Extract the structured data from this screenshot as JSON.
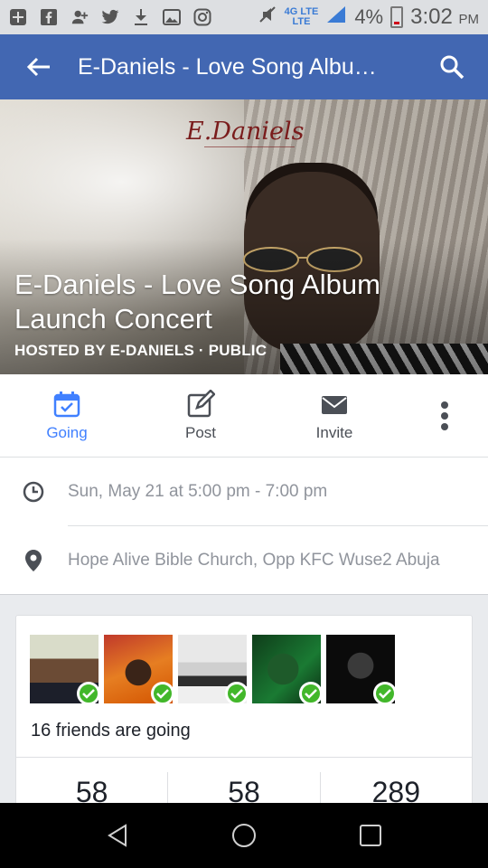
{
  "status_bar": {
    "network_line1": "4G LTE",
    "network_line2": "LTE",
    "battery": "4%",
    "time": "3:02",
    "ampm": "PM",
    "icons": [
      "add-box-icon",
      "facebook-icon",
      "user-add-icon",
      "twitter-icon",
      "download-icon",
      "image-icon",
      "instagram-icon",
      "mute-icon",
      "signal-icon",
      "battery-icon"
    ]
  },
  "appbar": {
    "title": "E-Daniels - Love Song Albu…",
    "back_icon": "arrow-left-icon",
    "search_icon": "search-icon"
  },
  "cover": {
    "logo_text": "E.Daniels",
    "title": "E-Daniels - Love Song Album Launch Concert",
    "hosted": "HOSTED BY E-DANIELS · PUBLIC"
  },
  "actions": {
    "going": "Going",
    "post": "Post",
    "invite": "Invite",
    "accent": "#4080ff"
  },
  "info": {
    "datetime": "Sun, May 21 at 5:00 pm - 7:00 pm",
    "location": "Hope Alive Bible Church, Opp KFC Wuse2 Abuja"
  },
  "friends": {
    "going_text": "16 friends are going",
    "stats": [
      "58",
      "58",
      "289"
    ],
    "check_color": "#42b72a"
  },
  "colors": {
    "facebook_blue": "#4267b2"
  }
}
